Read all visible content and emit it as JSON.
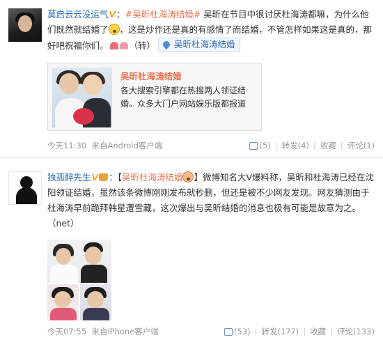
{
  "posts": [
    {
      "user": "莫启云云没运气",
      "text_prefix": "：",
      "topic": "#吴昕杜海涛结婚#",
      "text1": " 吴昕在节目中很讨厌杜海涛都嘛，为什么他们既然就结婚了",
      "text2": "，这是炒作还是真的有感情了而结婚，不管怎样如果这是真的，那好吧祝福你们。",
      "repost_marker": "（转）",
      "location_tag": "吴昕杜海涛结婚",
      "card": {
        "title": "吴昕杜海涛结婚",
        "desc": "各大搜索引擎都在热搜两人领证结婚。众多大门户网站娱乐版都报道"
      },
      "time": "今天11:30",
      "source": "来自Android客户端",
      "likes": "(5)",
      "reposts": "转发(4)",
      "favorite": "收藏",
      "comments": "评论(1)"
    },
    {
      "user": "独孤醉先生",
      "bracket_open": "：【",
      "topic": "吴昕杜海涛结婚",
      "bracket_close": "】",
      "text": "微博知名大V爆料称，吴昕和杜海涛已经在沈阳领证结婚，虽然该条微博刚刚发布就秒删，但还是被不少网友发现。网友猜测由于杜海涛早前跪拜韩星遭雪藏，这次爆出与吴昕结婚的消息也极有可能是故意为之。（net）",
      "time": "今天07:55",
      "source": "来自iPhone客户端",
      "likes": "(53)",
      "reposts": "转发(177)",
      "favorite": "收藏",
      "comments": "评论(133)"
    }
  ],
  "badge": "V",
  "icons": [
    "avatar",
    "verified-badge",
    "emoji-icon",
    "hearts-icon",
    "location-pin-icon",
    "like-icon",
    "crown-icon"
  ],
  "colors": {
    "link": "#2a6ab5",
    "topic": "#eb7350",
    "meta": "#999999"
  }
}
